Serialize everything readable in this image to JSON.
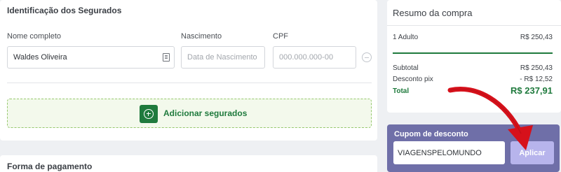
{
  "insured": {
    "title": "Identificação dos Segurados",
    "fields": {
      "name_label": "Nome completo",
      "name_value": "Waldes Oliveira",
      "birth_label": "Nascimento",
      "birth_placeholder": "Data de Nascimento",
      "cpf_label": "CPF",
      "cpf_placeholder": "000.000.000-00"
    },
    "add_button_label": "Adicionar segurados"
  },
  "payment": {
    "title": "Forma de pagamento"
  },
  "summary": {
    "title": "Resumo da compra",
    "item_label": "1 Adulto",
    "item_value": "R$ 250,43",
    "subtotal_label": "Subtotal",
    "subtotal_value": "R$ 250,43",
    "discount_label": "Desconto pix",
    "discount_value": "- R$ 12,52",
    "total_label": "Total",
    "total_value": "R$ 237,91"
  },
  "coupon": {
    "title": "Cupom de desconto",
    "code_value": "VIAGENSPELOMUNDO",
    "apply_label": "Aplicar"
  },
  "icons": {
    "id_card": "id-card-icon",
    "remove": "remove-circle-icon",
    "add": "add-circle-icon",
    "arrow": "red-arrow-annotation"
  },
  "colors": {
    "accent_green": "#1f7a3d",
    "coupon_purple": "#6f6fa8",
    "apply_button": "#b7b4ec",
    "annotation_red": "#d6111b"
  }
}
